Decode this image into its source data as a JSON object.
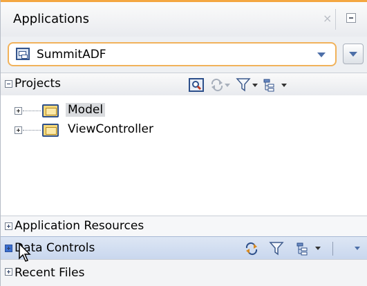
{
  "panel": {
    "title": "Applications",
    "close_glyph": "×"
  },
  "app_selector": {
    "selected": "SummitADF",
    "icon": "application-icon"
  },
  "sections": {
    "projects": "Projects",
    "application_resources": "Application Resources",
    "data_controls": "Data Controls",
    "recent_files": "Recent Files"
  },
  "tree": {
    "items": [
      {
        "label": "Model",
        "icon": "folder-icon",
        "selected": true
      },
      {
        "label": "ViewController",
        "icon": "folder-icon",
        "selected": false
      }
    ]
  },
  "toolbar_icons": {
    "projects": [
      "zoom-icon",
      "sync-icon",
      "filter-icon",
      "structure-icon"
    ],
    "data_controls": [
      "sync-icon",
      "filter-icon",
      "structure-icon"
    ]
  },
  "colors": {
    "accent": "#f4a741",
    "selection": "#d9dbde",
    "data_controls_header": "#c9d7ee"
  }
}
